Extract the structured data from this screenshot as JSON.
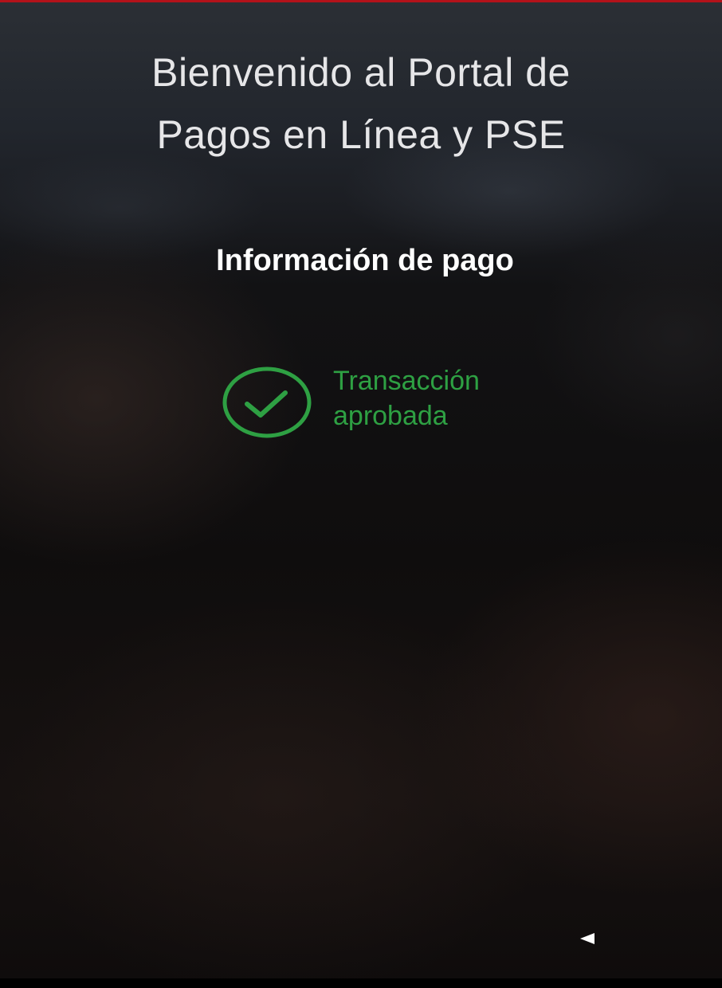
{
  "header": {
    "title_line1": "Bienvenido al Portal de",
    "title_line2": "Pagos en Línea y PSE"
  },
  "section": {
    "title": "Información de pago"
  },
  "status": {
    "icon": "check-circle-icon",
    "line1": "Transacción",
    "line2": "aprobada",
    "color": "#2ea043"
  },
  "navigation": {
    "back_icon": "back-arrow-icon"
  },
  "colors": {
    "accent": "#b3121a",
    "success": "#2ea043",
    "text": "#ffffff"
  }
}
